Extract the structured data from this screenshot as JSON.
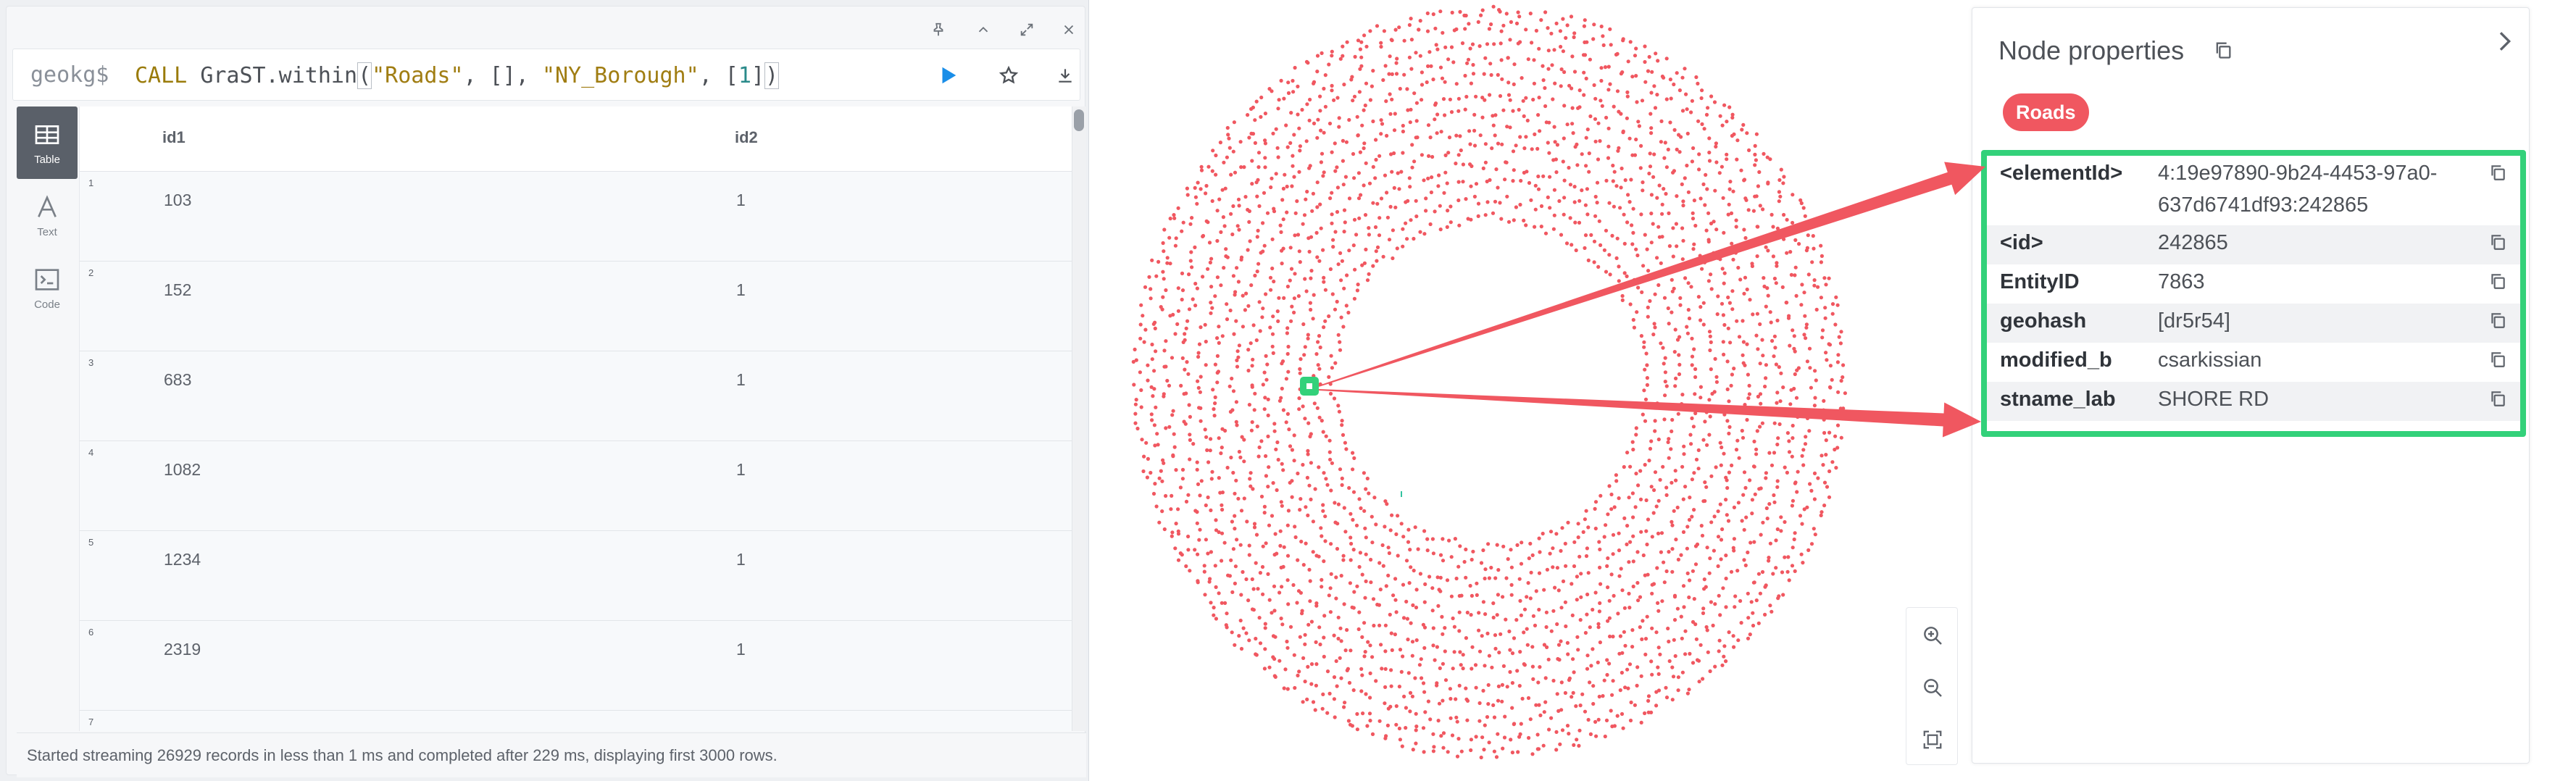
{
  "window_controls": {
    "pin": "pin-icon",
    "collapse": "chevron-up-icon",
    "fullscreen": "expand-icon",
    "close": "close-icon"
  },
  "editor": {
    "prompt": "geokg$",
    "query_tokens": [
      {
        "text": "CALL ",
        "class": "tok-kw"
      },
      {
        "text": "GraST.within",
        "class": "tok-br"
      },
      {
        "text": "(",
        "class": "tok-br cursor-box"
      },
      {
        "text": "\"Roads\"",
        "class": "tok-str"
      },
      {
        "text": ", [], ",
        "class": "tok-br"
      },
      {
        "text": "\"NY_Borough\"",
        "class": "tok-str"
      },
      {
        "text": ", [",
        "class": "tok-br"
      },
      {
        "text": "1",
        "class": "tok-num"
      },
      {
        "text": "]",
        "class": "tok-br"
      },
      {
        "text": ")",
        "class": "tok-br cursor-box"
      }
    ],
    "run_icon": "play-icon",
    "favorite_icon": "star-icon",
    "download_icon": "download-icon"
  },
  "view_tabs": [
    {
      "label": "Table",
      "icon": "table-icon",
      "active": true
    },
    {
      "label": "Text",
      "icon": "text-icon",
      "active": false
    },
    {
      "label": "Code",
      "icon": "code-icon",
      "active": false
    }
  ],
  "table": {
    "columns": [
      "id1",
      "id2"
    ],
    "rows": [
      {
        "num": "1",
        "id1": "103",
        "id2": "1"
      },
      {
        "num": "2",
        "id1": "152",
        "id2": "1"
      },
      {
        "num": "3",
        "id1": "683",
        "id2": "1"
      },
      {
        "num": "4",
        "id1": "1082",
        "id2": "1"
      },
      {
        "num": "5",
        "id1": "1234",
        "id2": "1"
      },
      {
        "num": "6",
        "id1": "2319",
        "id2": "1"
      },
      {
        "num": "7",
        "id1": "",
        "id2": ""
      }
    ]
  },
  "status": "Started streaming 26929 records in less than 1 ms and completed after 229 ms, displaying first 3000 rows.",
  "graph": {
    "node_color": "#f05760",
    "selected_color": "#33d17a",
    "arrow_color": "#f05760",
    "zoom_in_icon": "zoom-in-icon",
    "zoom_out_icon": "zoom-out-icon",
    "fit_icon": "fit-screen-icon"
  },
  "properties": {
    "title": "Node properties",
    "title_icon": "copy-icon",
    "collapse_icon": "chevron-right-icon",
    "label": "Roads",
    "label_color": "#f05760",
    "highlight_color": "#33d17a",
    "items": [
      {
        "key": "<elementId>",
        "value": "4:19e97890-9b24-4453-97a0-637d6741df93:242865"
      },
      {
        "key": "<id>",
        "value": "242865"
      },
      {
        "key": "EntityID",
        "value": "7863"
      },
      {
        "key": "geohash",
        "value": "[dr5r54]"
      },
      {
        "key": "modified_b",
        "value": "csarkissian"
      },
      {
        "key": "stname_lab",
        "value": "SHORE RD"
      }
    ]
  }
}
